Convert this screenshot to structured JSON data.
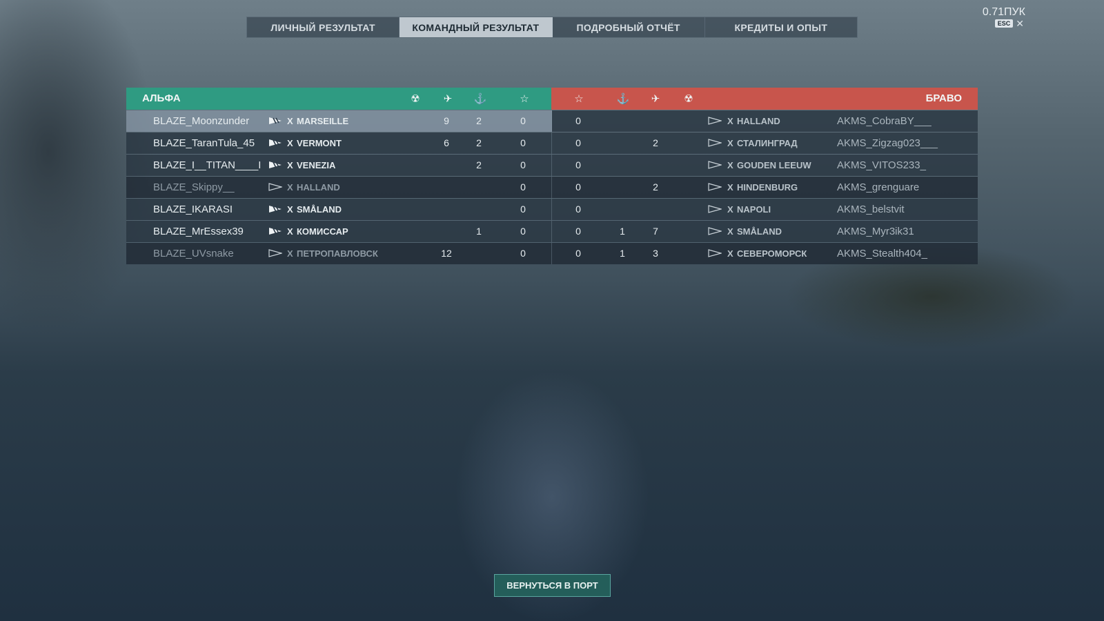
{
  "tabs": [
    {
      "label": "ЛИЧНЫЙ РЕЗУЛЬТАТ",
      "active": false
    },
    {
      "label": "КОМАНДНЫЙ РЕЗУЛЬТАТ",
      "active": true
    },
    {
      "label": "ПОДРОБНЫЙ ОТЧЁТ",
      "active": false
    },
    {
      "label": "КРЕДИТЫ И ОПЫТ",
      "active": false
    }
  ],
  "version": "0.71ПУК",
  "esc_label": "ESC",
  "close_glyph": "✕",
  "teams": {
    "left_name": "АЛЬФА",
    "right_name": "БРАВО",
    "left_color": "#2f9b82",
    "right_color": "#c8554c"
  },
  "column_icons": [
    "base-capture-icon",
    "planes-shot-icon",
    "ships-sunk-icon",
    "star-icon"
  ],
  "header_glyphs": {
    "capture": "☢",
    "planes": "✈",
    "ships": "⚓",
    "star": "☆"
  },
  "rows": [
    {
      "left": {
        "player": "BLAZE_Moonzunder",
        "tier": "X",
        "ship": "MARSEILLE",
        "planes": "9",
        "kills": "2",
        "star": "0",
        "ship_icon": "cruiser-premium-icon"
      },
      "right": {
        "star": "0",
        "kills": "",
        "planes": "",
        "tier": "X",
        "ship": "HALLAND",
        "player": "AKMS_CobraBY___",
        "ship_icon": "destroyer-icon"
      }
    },
    {
      "left": {
        "player": "BLAZE_TaranTula_45",
        "tier": "X",
        "ship": "VERMONT",
        "planes": "6",
        "kills": "2",
        "star": "0",
        "ship_icon": "battleship-icon"
      },
      "right": {
        "star": "0",
        "kills": "",
        "planes": "2",
        "tier": "X",
        "ship": "СТАЛИНГРАД",
        "player": "AKMS_Zigzag023___",
        "ship_icon": "cruiser-icon"
      }
    },
    {
      "left": {
        "player": "BLAZE_I__TITAN____I",
        "tier": "X",
        "ship": "VENEZIA",
        "planes": "",
        "kills": "2",
        "star": "0",
        "ship_icon": "cruiser-icon"
      },
      "right": {
        "star": "0",
        "kills": "",
        "planes": "",
        "tier": "X",
        "ship": "GOUDEN LEEUW",
        "player": "AKMS_VITOS233_",
        "ship_icon": "cruiser-icon"
      }
    },
    {
      "left": {
        "player": "BLAZE_Skippy__",
        "tier": "X",
        "ship": "HALLAND",
        "planes": "",
        "kills": "",
        "star": "0",
        "ship_icon": "destroyer-icon",
        "sunk": true
      },
      "right": {
        "star": "0",
        "kills": "",
        "planes": "2",
        "tier": "X",
        "ship": "HINDENBURG",
        "player": "AKMS_grenguare",
        "ship_icon": "cruiser-icon"
      }
    },
    {
      "left": {
        "player": "BLAZE_IKARASI",
        "tier": "X",
        "ship": "SMÅLAND",
        "planes": "",
        "kills": "",
        "star": "0",
        "ship_icon": "destroyer-icon"
      },
      "right": {
        "star": "0",
        "kills": "",
        "planes": "",
        "tier": "X",
        "ship": "NAPOLI",
        "player": "AKMS_belstvit",
        "ship_icon": "cruiser-icon"
      }
    },
    {
      "left": {
        "player": "BLAZE_MrEssex39",
        "tier": "X",
        "ship": "КОМИССАР",
        "planes": "",
        "kills": "1",
        "star": "0",
        "ship_icon": "cruiser-icon"
      },
      "right": {
        "star": "0",
        "kills": "1",
        "planes": "7",
        "tier": "X",
        "ship": "SMÅLAND",
        "player": "AKMS_Myr3ik31",
        "ship_icon": "destroyer-icon"
      }
    },
    {
      "left": {
        "player": "BLAZE_UVsnake",
        "tier": "X",
        "ship": "ПЕТРОПАВЛОВСК",
        "planes": "12",
        "kills": "",
        "star": "0",
        "ship_icon": "cruiser-icon",
        "sunk": true
      },
      "right": {
        "star": "0",
        "kills": "1",
        "planes": "3",
        "tier": "X",
        "ship": "СЕВЕРОМОРСК",
        "player": "AKMS_Stealth404_",
        "ship_icon": "cruiser-icon"
      }
    }
  ],
  "return_button": "ВЕРНУТЬСЯ В ПОРТ"
}
